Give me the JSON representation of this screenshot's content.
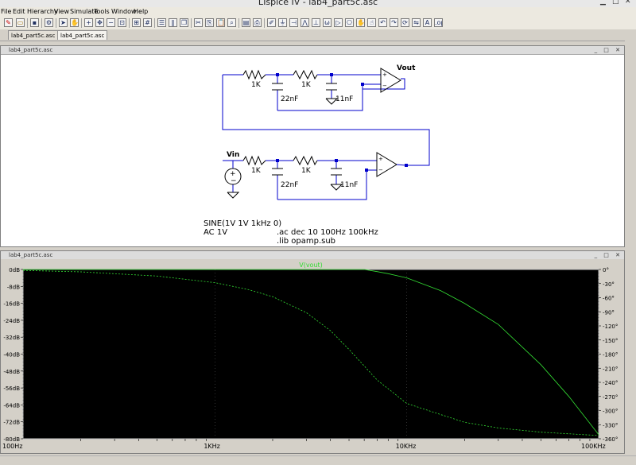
{
  "app": {
    "title": "LTspice IV - lab4_part5c.asc"
  },
  "menu": [
    "File",
    "Edit",
    "Hierarchy",
    "View",
    "Simulate",
    "Tools",
    "Window",
    "Help"
  ],
  "doc_tabs": [
    {
      "label": "lab4_part5c.asc"
    },
    {
      "label": "lab4_part5c.asc"
    }
  ],
  "schematic_window": {
    "title": "lab4_part5c.asc",
    "labels": {
      "r1": "1K",
      "r2": "1K",
      "c1": "22nF",
      "c2": "11nF",
      "vout": "Vout",
      "r3": "1K",
      "r4": "1K",
      "c3": "22nF",
      "c4": "11nF",
      "vin": "Vin"
    },
    "directives": {
      "source_line1": "SINE(1V 1V 1kHz 0)",
      "source_line2": "AC 1V",
      "ac": ".ac dec 10 100Hz 100kHz",
      "lib": ".lib opamp.sub"
    }
  },
  "plot_window": {
    "title": "lab4_part5c.asc"
  },
  "chart_data": {
    "type": "line",
    "title": "V(vout)",
    "x_scale": "log",
    "xlim": [
      100,
      100000
    ],
    "x_ticks": [
      "100Hz",
      "1KHz",
      "10KHz",
      "100KHz"
    ],
    "y_left_ticks": [
      "0dB",
      "-8dB",
      "-16dB",
      "-24dB",
      "-32dB",
      "-40dB",
      "-48dB",
      "-56dB",
      "-64dB",
      "-72dB",
      "-80dB"
    ],
    "y_right_ticks": [
      "0°",
      "-30°",
      "-60°",
      "-90°",
      "-120°",
      "-150°",
      "-180°",
      "-210°",
      "-240°",
      "-270°",
      "-300°",
      "-330°",
      "-360°"
    ],
    "ylim_left": [
      -80,
      0
    ],
    "ylim_right": [
      -360,
      0
    ],
    "background": "#000000",
    "trace_color": "#33dd33",
    "series": [
      {
        "name": "V(vout)",
        "axis": "left",
        "style": "solid",
        "x": [
          100,
          200,
          500,
          1000,
          2000,
          3000,
          4000,
          5000,
          6000,
          7000,
          8000,
          10000,
          15000,
          20000,
          30000,
          50000,
          70000,
          100000
        ],
        "y": [
          0,
          0,
          0,
          0,
          0,
          0,
          0,
          0,
          0,
          -1,
          -2,
          -4,
          -10,
          -16,
          -26,
          -45,
          -60,
          -78
        ]
      },
      {
        "name": "phase",
        "axis": "right",
        "style": "dashed",
        "x": [
          100,
          200,
          500,
          1000,
          1500,
          2000,
          3000,
          4000,
          5000,
          7000,
          10000,
          20000,
          30000,
          50000,
          100000
        ],
        "y": [
          -2,
          -5,
          -14,
          -28,
          -43,
          -58,
          -92,
          -130,
          -170,
          -235,
          -285,
          -325,
          -337,
          -346,
          -353
        ]
      }
    ]
  }
}
